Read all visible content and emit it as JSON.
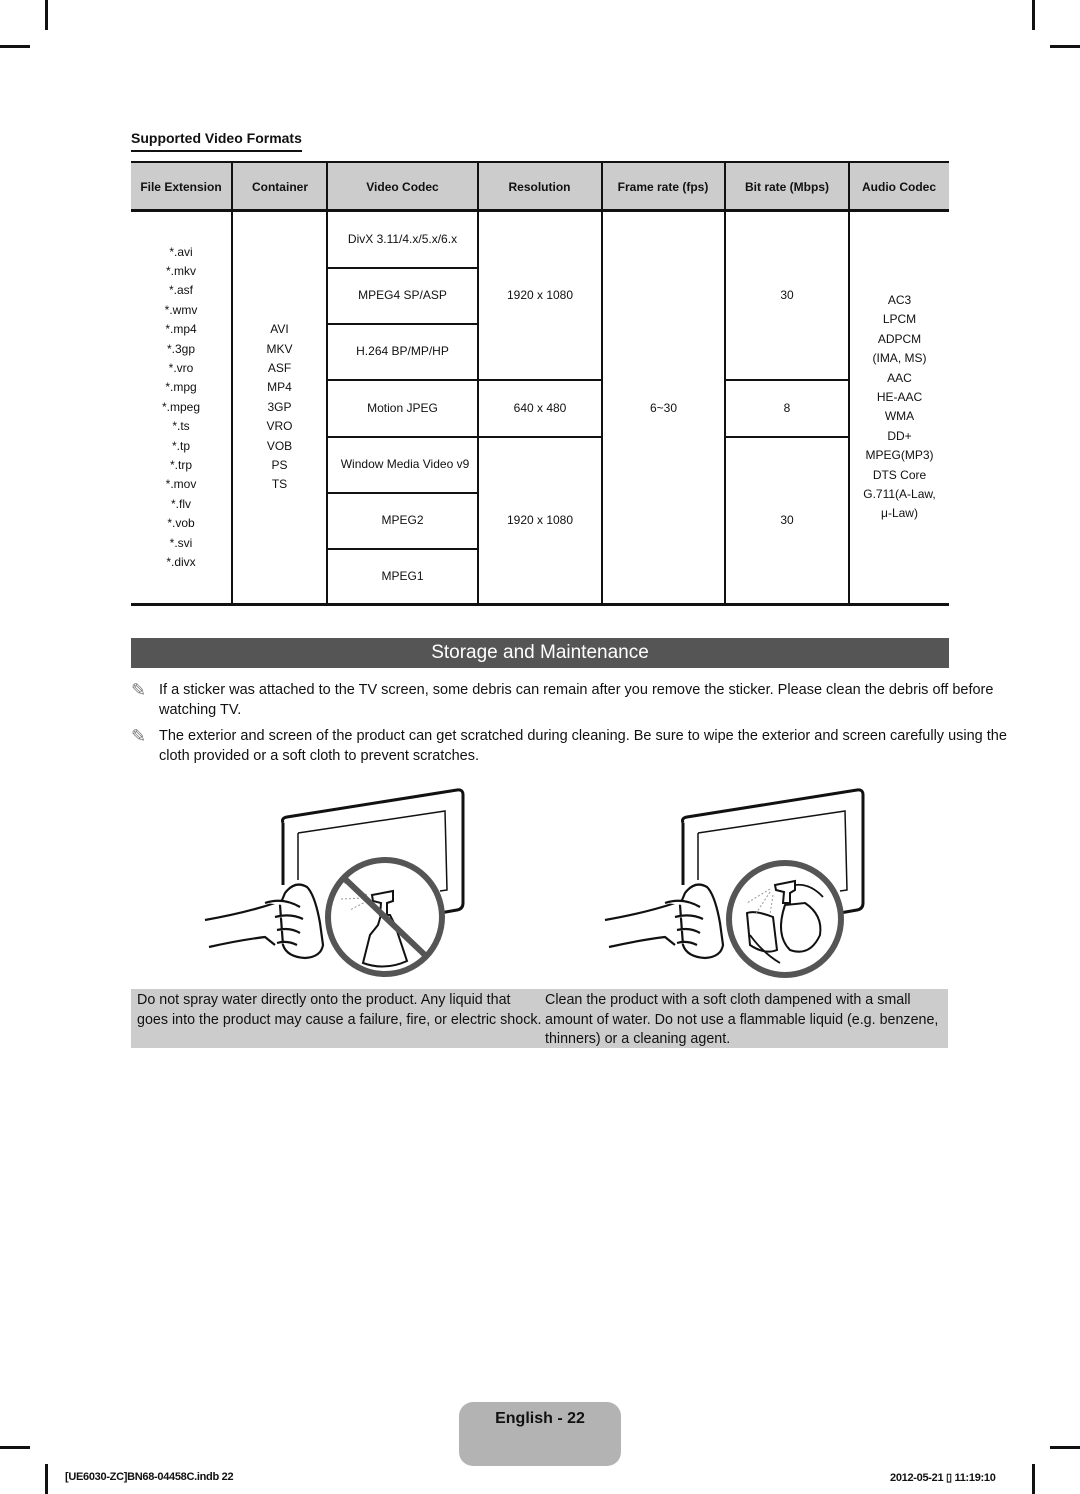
{
  "section_title": "Supported Video Formats",
  "table": {
    "headers": [
      "File Extension",
      "Container",
      "Video Codec",
      "Resolution",
      "Frame rate (fps)",
      "Bit rate (Mbps)",
      "Audio Codec"
    ],
    "file_extensions": [
      "*.avi",
      "*.mkv",
      "*.asf",
      "*.wmv",
      "*.mp4",
      "*.3gp",
      "*.vro",
      "*.mpg",
      "*.mpeg",
      "*.ts",
      "*.tp",
      "*.trp",
      "*.mov",
      "*.flv",
      "*.vob",
      "*.svi",
      "*.divx"
    ],
    "containers": [
      "AVI",
      "MKV",
      "ASF",
      "MP4",
      "3GP",
      "VRO",
      "VOB",
      "PS",
      "TS"
    ],
    "video_codecs": [
      "DivX 3.11/4.x/5.x/6.x",
      "MPEG4 SP/ASP",
      "H.264 BP/MP/HP",
      "Motion JPEG",
      "Window Media Video v9",
      "MPEG2",
      "MPEG1"
    ],
    "resolutions": [
      "1920 x 1080",
      "640 x 480",
      "1920 x 1080"
    ],
    "frame_rate": "6~30",
    "bit_rates": [
      "30",
      "8",
      "30"
    ],
    "audio_codecs": [
      "AC3",
      "LPCM",
      "ADPCM",
      "(IMA, MS)",
      "AAC",
      "HE-AAC",
      "WMA",
      "DD+",
      "MPEG(MP3)",
      "DTS Core",
      "G.711(A-Law,",
      "μ-Law)"
    ]
  },
  "storage": {
    "title": "Storage and Maintenance",
    "notes": [
      "If a sticker was attached to the TV screen, some debris can remain after you remove the sticker. Please clean the debris off before watching TV.",
      "The exterior and screen of the product can get scratched during cleaning. Be sure to wipe the exterior and screen carefully using the cloth provided or a soft cloth to prevent scratches."
    ],
    "captions": [
      "Do not spray water directly onto the product. Any liquid that goes into the product may cause a failure, fire, or electric shock.",
      "Clean the product with a soft cloth dampened with a small amount of water. Do not use a flammable liquid (e.g. benzene, thinners) or a cleaning agent."
    ],
    "illustrations": [
      "wipe-tv-no-spray",
      "wipe-tv-dampened-cloth"
    ]
  },
  "page_label": "English - 22",
  "footer": {
    "left": "[UE6030-ZC]BN68-04458C.indb   22",
    "right": "2012-05-21   ▯ 11:19:10"
  }
}
